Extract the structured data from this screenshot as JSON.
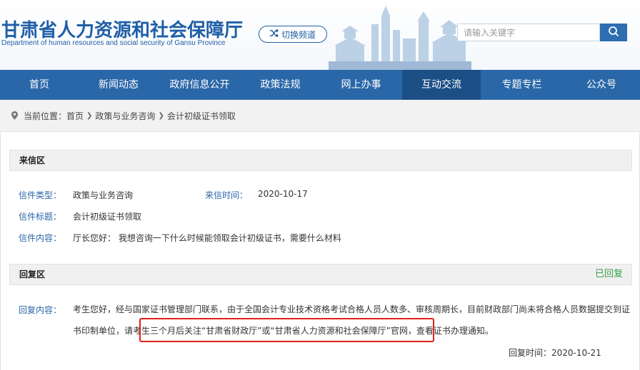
{
  "header": {
    "title": "甘肃省人力资源和社会保障厅",
    "subtitle": "Department of human resources and social security of Gansu Province",
    "switch_label": "切换频道",
    "search_placeholder": "请输入关键字"
  },
  "nav": {
    "items": [
      {
        "label": "首页"
      },
      {
        "label": "新闻动态"
      },
      {
        "label": "政府信息公开"
      },
      {
        "label": "政策法规"
      },
      {
        "label": "网上办事"
      },
      {
        "label": "互动交流"
      },
      {
        "label": "专题专栏"
      },
      {
        "label": "公众号"
      }
    ]
  },
  "breadcrumb": {
    "prefix": "当前位置：",
    "items": [
      "首页",
      "政策与业务咨询",
      "会计初级证书领取"
    ]
  },
  "letter": {
    "section_title": "来信区",
    "type_label": "信件类型：",
    "type_value": "政策与业务咨询",
    "time_label": "来信时间：",
    "time_value": "2020-10-17",
    "subject_label": "信件标题：",
    "subject_value": "会计初级证书领取",
    "body_label": "信件内容：",
    "body_value": "厅长您好： 我想咨询一下什么时候能领取会计初级证书，需要什么材料"
  },
  "reply": {
    "section_title": "回复区",
    "status": "已回复",
    "body_label": "回复内容：",
    "body_value": "考生您好，经与国家证书管理部门联系，由于全国会计专业技术资格考试合格人员人数多、审核周期长，目前财政部门尚未将合格人员数据提交到证书印制单位，请考生三个月后关注“甘肃省财政厅”或“甘肃省人力资源和社会保障厅”官网，查看证书办理通知。",
    "time_label": "回复时间：",
    "time_value": "2020-10-21"
  },
  "colors": {
    "brand": "#2a67a8",
    "nav_active": "#1c4f86",
    "replied": "#3aa14a",
    "highlight": "#e0201b"
  }
}
